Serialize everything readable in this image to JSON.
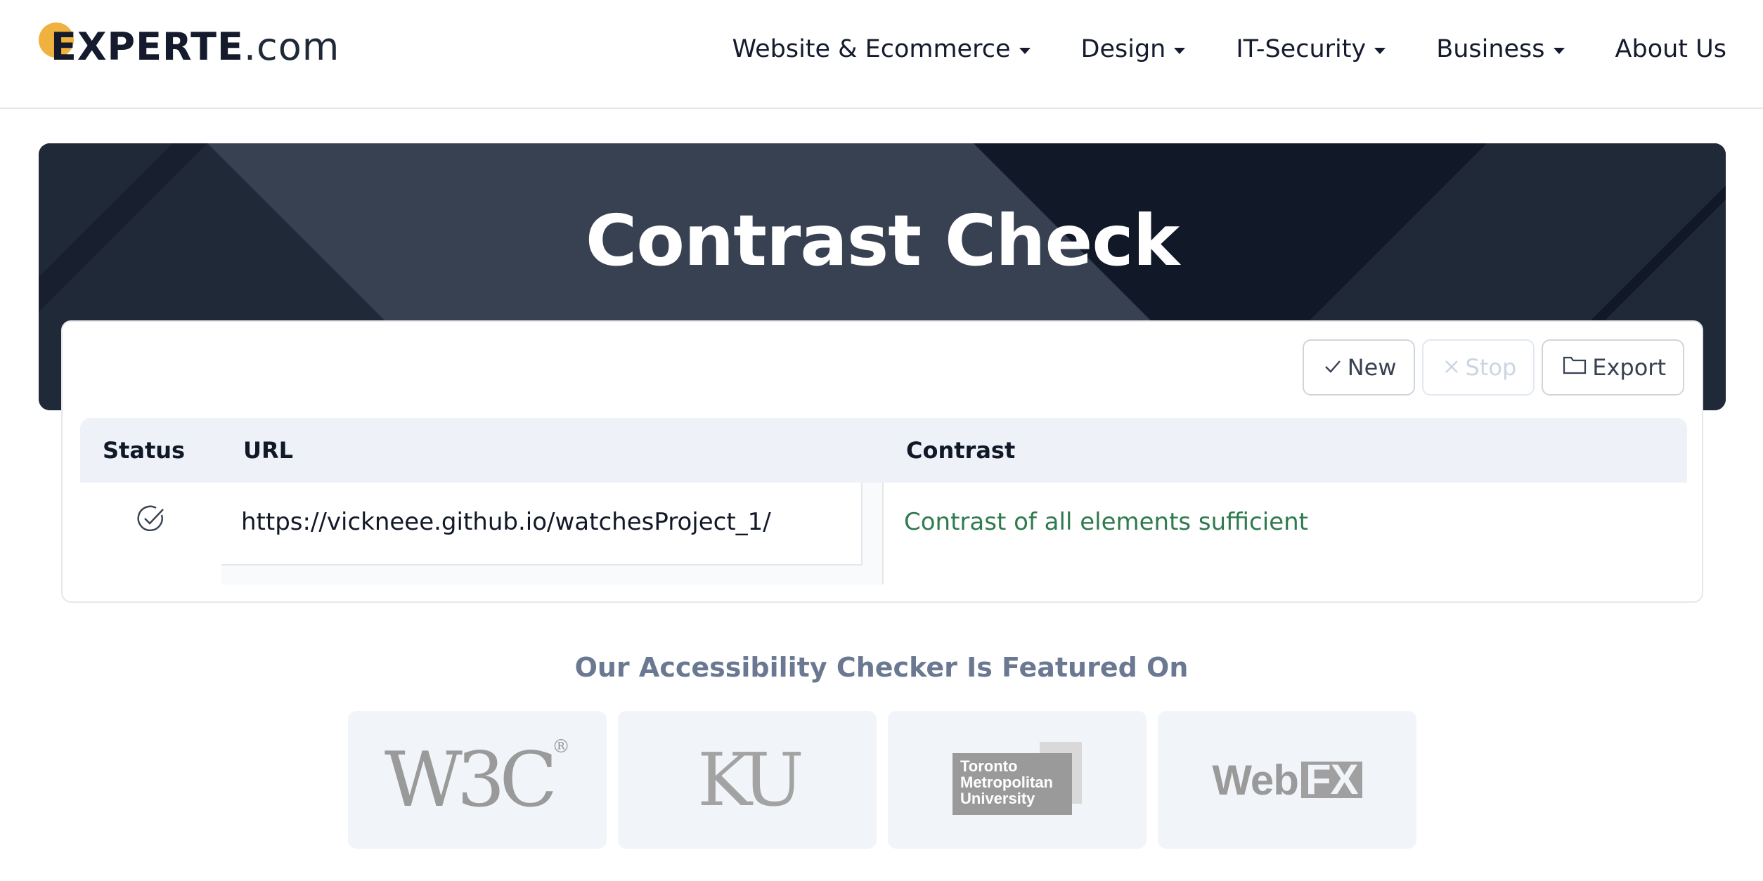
{
  "header": {
    "logo": {
      "brand": "EXPERTE",
      "tld": ".com"
    },
    "nav": [
      {
        "label": "Website & Ecommerce",
        "has_dropdown": true,
        "active": true
      },
      {
        "label": "Design",
        "has_dropdown": true
      },
      {
        "label": "IT-Security",
        "has_dropdown": true
      },
      {
        "label": "Business",
        "has_dropdown": true
      },
      {
        "label": "About Us",
        "has_dropdown": false
      }
    ]
  },
  "hero": {
    "title": "Contrast Check"
  },
  "toolbar": {
    "new_label": "New",
    "stop_label": "Stop",
    "export_label": "Export"
  },
  "table": {
    "columns": [
      "Status",
      "URL",
      "Contrast"
    ],
    "rows": [
      {
        "status": "check-circle-icon",
        "url": "https://vickneee.github.io/watchesProject_1/",
        "contrast": "Contrast of all elements sufficient"
      }
    ]
  },
  "featured": {
    "title": "Our Accessibility Checker Is Featured On",
    "logos": [
      {
        "name": "W3C",
        "text": "W3C",
        "mark": "®"
      },
      {
        "name": "KU",
        "text": "KU"
      },
      {
        "name": "Toronto Metropolitan University",
        "lines": [
          "Toronto",
          "Metropolitan",
          "University"
        ]
      },
      {
        "name": "WebFX",
        "text": "Web",
        "accent": "FX"
      }
    ]
  },
  "colors": {
    "accent_yellow": "#f0b23e",
    "hero_dark": "#111827",
    "success_green": "#2f7a4e",
    "muted_title": "#6b7891"
  }
}
